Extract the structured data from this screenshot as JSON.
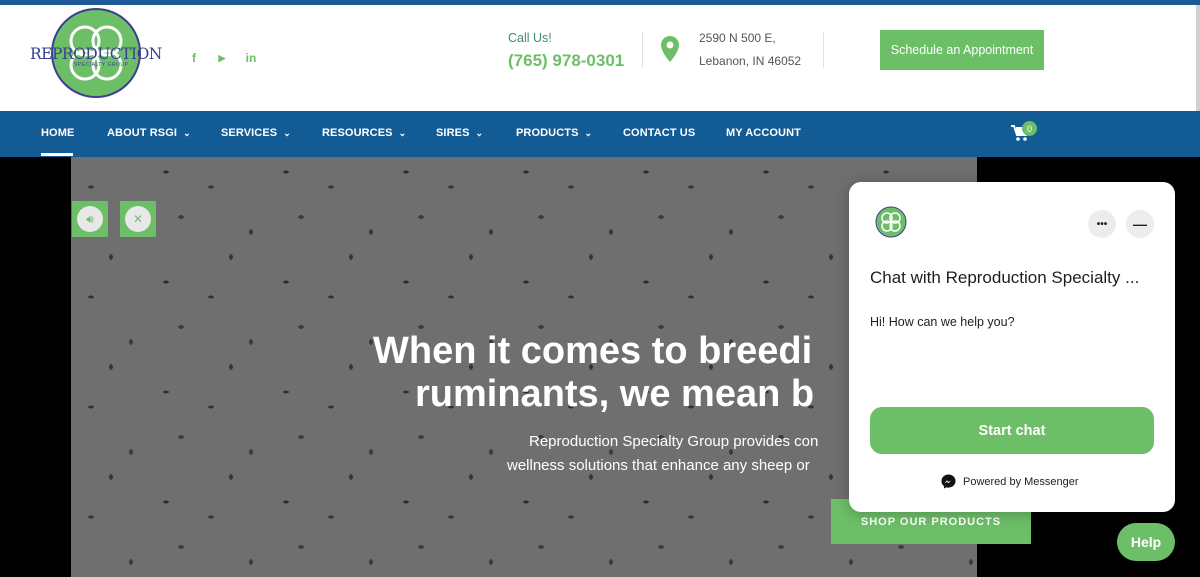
{
  "header": {
    "logo": {
      "name": "REPRODUCTION",
      "tagline": "SPECIALTY GROUP"
    },
    "social": [
      {
        "icon": "facebook-icon",
        "glyph": "f"
      },
      {
        "icon": "youtube-icon",
        "glyph": "▶"
      },
      {
        "icon": "linkedin-icon",
        "glyph": "in"
      }
    ],
    "call_label": "Call Us!",
    "phone": "(765) 978-0301",
    "address_line1": "2590 N 500 E,",
    "address_line2": "Lebanon, IN 46052",
    "schedule_button": "Schedule an Appointment"
  },
  "nav": {
    "items": [
      {
        "label": "HOME",
        "dropdown": false,
        "active": true
      },
      {
        "label": "ABOUT RSGI",
        "dropdown": true
      },
      {
        "label": "SERVICES",
        "dropdown": true
      },
      {
        "label": "RESOURCES",
        "dropdown": true
      },
      {
        "label": "SIRES",
        "dropdown": true
      },
      {
        "label": "PRODUCTS",
        "dropdown": true
      },
      {
        "label": "CONTACT US",
        "dropdown": false
      },
      {
        "label": "MY ACCOUNT",
        "dropdown": false
      }
    ],
    "cart_count": "0"
  },
  "hero": {
    "title_line1": "When it comes to breedi",
    "title_line2": "ruminants, we mean b",
    "subtitle_line1": "Reproduction Specialty Group provides con",
    "subtitle_line2": "wellness solutions that enhance any sheep or",
    "shop_button": "SHOP OUR PRODUCTS",
    "sound_on_icon": "speaker-on-icon",
    "sound_off_icon": "speaker-mute-icon"
  },
  "chat": {
    "title": "Chat with Reproduction Specialty ...",
    "greeting": "Hi! How can we help you?",
    "start_button": "Start chat",
    "powered_by": "Powered by Messenger",
    "more_label": "•••",
    "minimize_label": "—"
  },
  "help_button": "Help",
  "colors": {
    "brand_green": "#6dbf67",
    "nav_blue": "#135b95",
    "logo_purple": "#3b3f8f"
  }
}
